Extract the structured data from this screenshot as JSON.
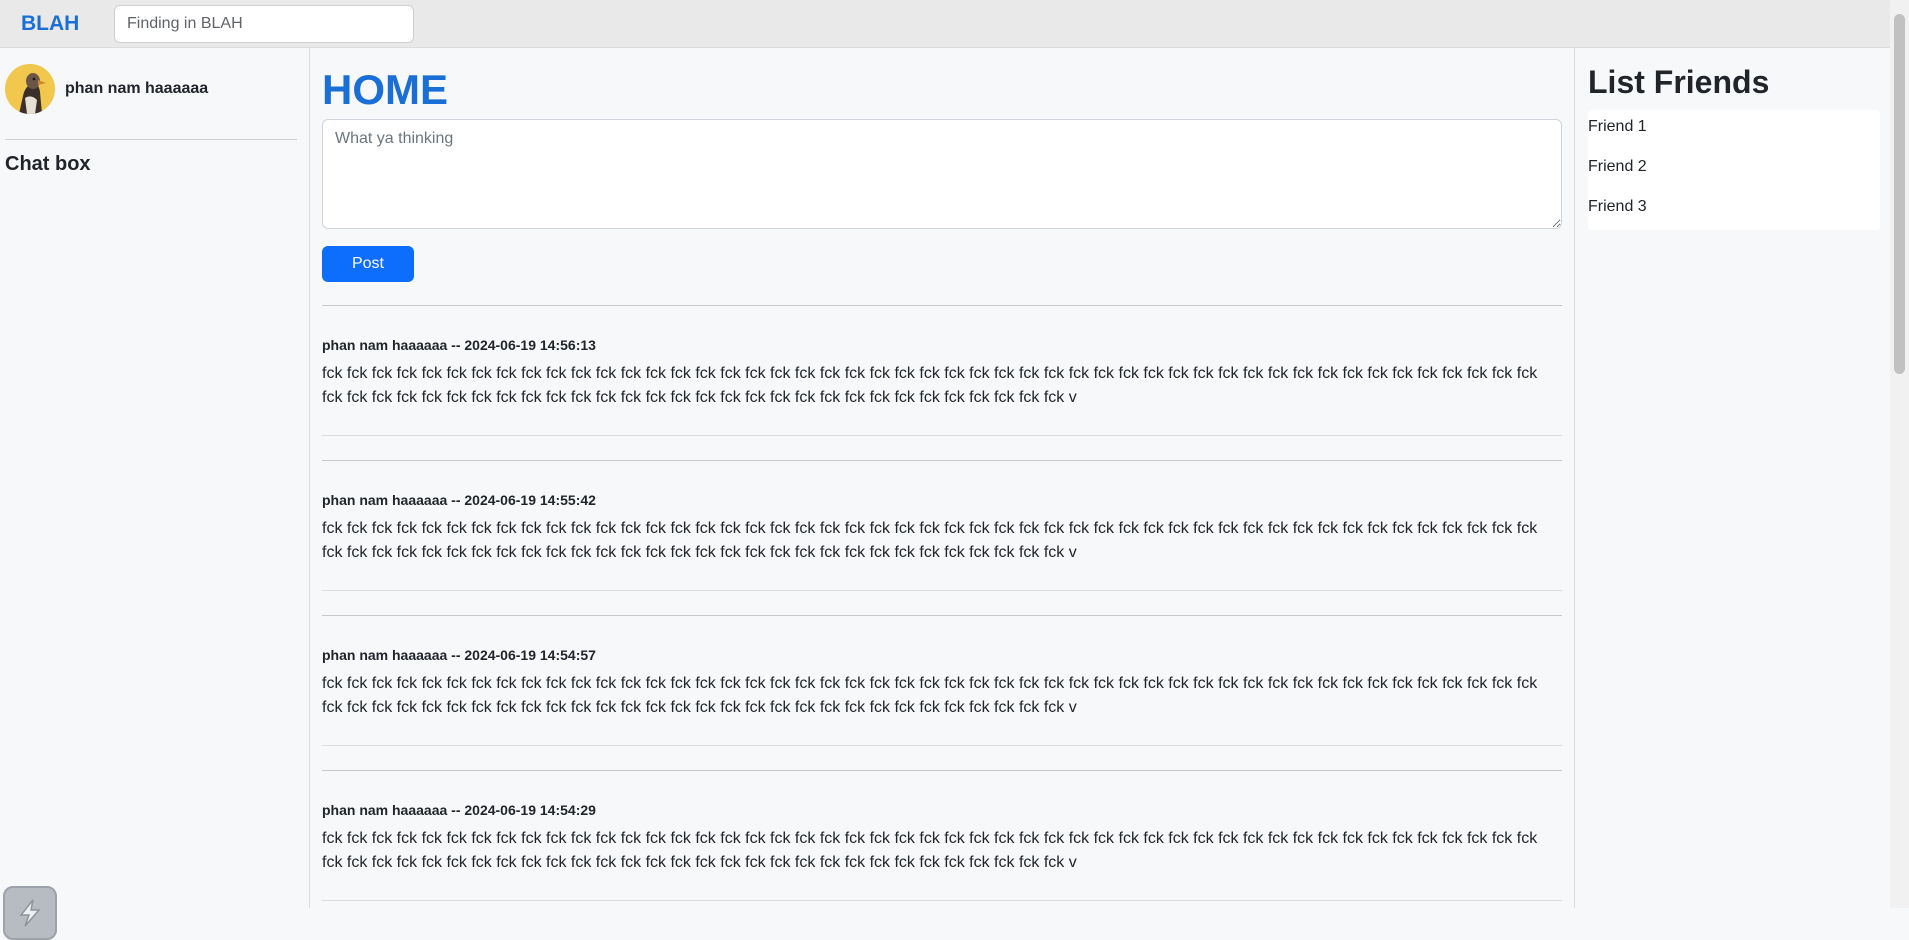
{
  "header": {
    "brand": "BLAH",
    "search_placeholder": "Finding in BLAH"
  },
  "sidebar": {
    "user_name": "phan nam haaaaaa",
    "chat_title": "Chat box"
  },
  "main": {
    "title": "HOME",
    "composer_placeholder": "What ya thinking",
    "post_button": "Post"
  },
  "posts": [
    {
      "meta": "phan nam haaaaaa -- 2024-06-19 14:56:13",
      "content": "fck fck fck fck fck fck fck fck fck fck fck fck fck fck fck fck fck fck fck fck fck fck fck fck fck fck fck fck fck fck fck fck fck fck fck fck fck fck fck fck fck fck fck fck fck fck fck fck fck fck fck fck fck fck fck fck fck fck fck fck fck fck fck fck fck fck fck fck fck fck fck fck fck fck fck fck fck fck fck v"
    },
    {
      "meta": "phan nam haaaaaa -- 2024-06-19 14:55:42",
      "content": "fck fck fck fck fck fck fck fck fck fck fck fck fck fck fck fck fck fck fck fck fck fck fck fck fck fck fck fck fck fck fck fck fck fck fck fck fck fck fck fck fck fck fck fck fck fck fck fck fck fck fck fck fck fck fck fck fck fck fck fck fck fck fck fck fck fck fck fck fck fck fck fck fck fck fck fck fck fck fck v"
    },
    {
      "meta": "phan nam haaaaaa -- 2024-06-19 14:54:57",
      "content": "fck fck fck fck fck fck fck fck fck fck fck fck fck fck fck fck fck fck fck fck fck fck fck fck fck fck fck fck fck fck fck fck fck fck fck fck fck fck fck fck fck fck fck fck fck fck fck fck fck fck fck fck fck fck fck fck fck fck fck fck fck fck fck fck fck fck fck fck fck fck fck fck fck fck fck fck fck fck fck v"
    },
    {
      "meta": "phan nam haaaaaa -- 2024-06-19 14:54:29",
      "content": "fck fck fck fck fck fck fck fck fck fck fck fck fck fck fck fck fck fck fck fck fck fck fck fck fck fck fck fck fck fck fck fck fck fck fck fck fck fck fck fck fck fck fck fck fck fck fck fck fck fck fck fck fck fck fck fck fck fck fck fck fck fck fck fck fck fck fck fck fck fck fck fck fck fck fck fck fck fck fck v"
    }
  ],
  "friends": {
    "title": "List Friends",
    "items": [
      "Friend 1",
      "Friend 2",
      "Friend 3"
    ]
  },
  "colors": {
    "brand": "#1a6fd6",
    "primary_button": "#0d6efd"
  },
  "icons": {
    "avatar": "duck-avatar",
    "floating_widget": "lightning-widget-icon"
  }
}
